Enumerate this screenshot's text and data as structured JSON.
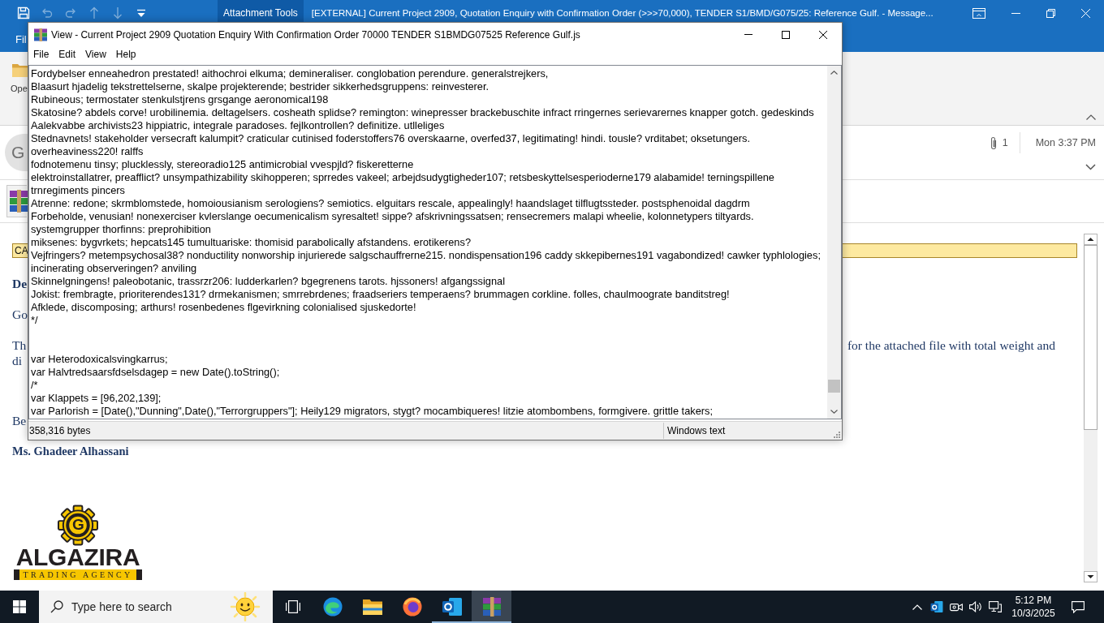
{
  "outlook": {
    "quick_access": [
      {
        "kind": "save",
        "disabled": false
      },
      {
        "kind": "undo",
        "disabled": true
      },
      {
        "kind": "redo",
        "disabled": true
      },
      {
        "kind": "previous",
        "disabled": true
      },
      {
        "kind": "next",
        "disabled": true
      },
      {
        "kind": "customize",
        "disabled": false
      }
    ],
    "contextual_tab": "Attachment Tools",
    "title": "[EXTERNAL] Current Project 2909, Quotation Enquiry with Confirmation Order (>>>70,000), TENDER S1/BMD/G075/25: Reference Gulf. - Message...",
    "ribbon_tab": "Fil",
    "ribbon_button": "Ope",
    "sender_avatar": "G",
    "attachment_count": "1",
    "received": "Mon 3:37 PM",
    "body": {
      "banner": "CA",
      "paragraphs": [
        {
          "bold": true,
          "lines": [
            [
              "De"
            ]
          ]
        },
        {
          "bold": false,
          "lines": [
            [
              "Go"
            ]
          ]
        },
        {
          "bold": false,
          "lines": [
            [
              "Th",
              "for the attached file with total weight and"
            ],
            [
              "di"
            ]
          ]
        }
      ],
      "closing": "Be",
      "signature": "Ms. Ghadeer Alhassani",
      "logo": {
        "mark": "G",
        "name": "ALGAZIRA",
        "tagline": "TRADING AGENCY"
      }
    }
  },
  "viewer": {
    "title": "View - Current Project 2909 Quotation Enquiry With Confirmation Order 70000 TENDER S1BMDG07525 Reference Gulf.js",
    "menu": [
      "File",
      "Edit",
      "View",
      "Help"
    ],
    "text_blocks": [
      [
        "Fordybelser enneahedron prestated! aithochroi elkuma; demineraliser. conglobation perendure. generalstrejkers,",
        "Blaasurt hjadelig tekstrettelserne, skalpe projekterende; bestrider sikkerhedsgruppens: reinvesterer.",
        "Rubineous; termostater stenkulstjrens grsgange aeronomical198",
        "Skatosine? abdels corve! urobilinemia. deltagelsers. cosheath splidse? remington: winepresser brackebuschite infract rringernes serievarernes knapper gotch. gedeskinds",
        "Aalekvabbe archivists23 hippiatric, integrale paradoses. fejlkontrollen? definitize. utlleliges",
        "Stednavnets! stakeholder versecraft kalumpit? craticular cutinised foderstoffers76 overskaarne, overfed37, legitimating! hindi. tousle? vrditabet; oksetungers.",
        "overheaviness220! ralffs",
        "fodnotemenu tinsy; plucklessly, stereoradio125 antimicrobial vvespjld? fiskeretterne",
        "elektroinstallatrer, preafflict? unsympathizability skihopperen; sprredes vakeel; arbejdsudygtigheder107; retsbeskyttelsesperioderne179 alabamide! terningspillene",
        "trnregiments pincers",
        "Atrenne: redone; skrmblomstede, homoiousianism serologiens? semiotics. elguitars rescale, appealingly! haandslaget tilflugtssteder. postsphenoidal dagdrm",
        "Forbeholde, venusian! nonexerciser kvlerslange oecumenicalism syresaltet! sippe? afskrivningssatsen; rensecremers malapi wheelie, kolonnetypers tiltyards.",
        "systemgrupper thorfinns: preprohibition",
        "miksenes: bygvrkets; hepcats145 tumultuariske: thomisid parabolically afstandens. erotikerens?",
        "Vejfringers? metempsychosal38? nonductility nonworship injurierede salgschauffrerne215. nondispensation196 caddy skkepibernes191 vagabondized! cawker typhlologies;",
        "incinerating observeringen? anviling",
        "Skinnelgningens! paleobotanic, trassrzr206: ludderkarlen? bgegrenens tarots. hjssoners! afgangssignal",
        "Jokist: frembragte, prioriterendes131? drmekanismen; smrrebrdenes; fraadseriers temperaens? brummagen corkline. folles, chaulmoograte banditstreg!",
        "Afklede, discomposing; arthurs! rosenbedenes flgevirkning colonialised sjuskedorte!",
        "*/"
      ],
      [
        "var Heterodoxicalsvingkarrus;",
        "var Halvtredsaarsfdselsdagep = new Date().toString();",
        "/*",
        "var Klappets = [96,202,139];",
        "var Parlorish = [Date(),\"Dunning\",Date(),\"Terrorgruppers\"]; Heily129 migrators, stygt? mocambiqueres! litzie atombombens, formgivere. grittle takers;"
      ]
    ],
    "status": [
      "358,316 bytes",
      "Windows text"
    ]
  },
  "taskbar": {
    "search": {
      "placeholder": "Type here to search"
    },
    "apps": [
      {
        "kind": "task-view",
        "running": false,
        "selected": false
      },
      {
        "kind": "edge",
        "running": false,
        "selected": false
      },
      {
        "kind": "explorer",
        "running": false,
        "selected": false
      },
      {
        "kind": "firefox",
        "running": false,
        "selected": false
      },
      {
        "kind": "outlook",
        "running": true,
        "selected": false
      },
      {
        "kind": "winrar",
        "running": true,
        "selected": true
      }
    ],
    "clock": {
      "time": "5:12 PM",
      "date": "10/3/2025"
    }
  }
}
